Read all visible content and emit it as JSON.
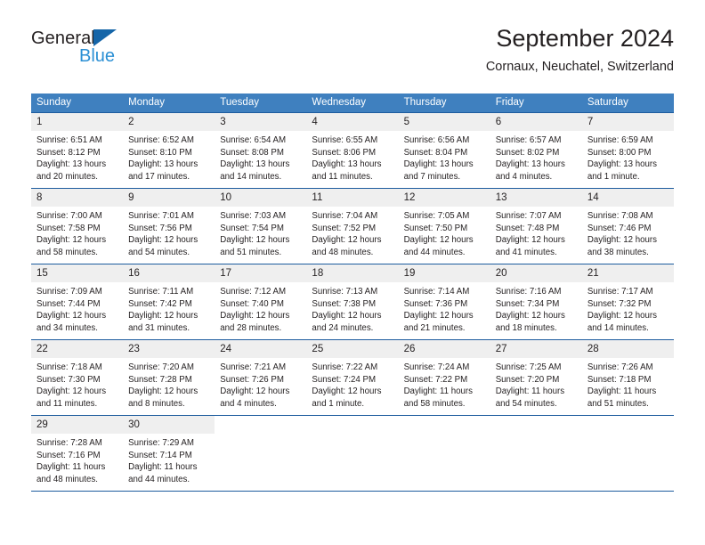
{
  "brand": {
    "name_part1": "General",
    "name_part2": "Blue",
    "logo_icon": "triangle-icon",
    "colors": {
      "dark": "#231f20",
      "blue": "#2a8fd4",
      "triangle": "#1565a8"
    }
  },
  "header": {
    "title": "September 2024",
    "subtitle": "Cornaux, Neuchatel, Switzerland"
  },
  "calendar": {
    "accent_header_bg": "#3f80bf",
    "row_border": "#1d5c9e",
    "daynum_bg": "#efefef",
    "weekdays": [
      "Sunday",
      "Monday",
      "Tuesday",
      "Wednesday",
      "Thursday",
      "Friday",
      "Saturday"
    ],
    "weeks": [
      [
        {
          "day": "1",
          "sunrise": "Sunrise: 6:51 AM",
          "sunset": "Sunset: 8:12 PM",
          "daylight": "Daylight: 13 hours and 20 minutes."
        },
        {
          "day": "2",
          "sunrise": "Sunrise: 6:52 AM",
          "sunset": "Sunset: 8:10 PM",
          "daylight": "Daylight: 13 hours and 17 minutes."
        },
        {
          "day": "3",
          "sunrise": "Sunrise: 6:54 AM",
          "sunset": "Sunset: 8:08 PM",
          "daylight": "Daylight: 13 hours and 14 minutes."
        },
        {
          "day": "4",
          "sunrise": "Sunrise: 6:55 AM",
          "sunset": "Sunset: 8:06 PM",
          "daylight": "Daylight: 13 hours and 11 minutes."
        },
        {
          "day": "5",
          "sunrise": "Sunrise: 6:56 AM",
          "sunset": "Sunset: 8:04 PM",
          "daylight": "Daylight: 13 hours and 7 minutes."
        },
        {
          "day": "6",
          "sunrise": "Sunrise: 6:57 AM",
          "sunset": "Sunset: 8:02 PM",
          "daylight": "Daylight: 13 hours and 4 minutes."
        },
        {
          "day": "7",
          "sunrise": "Sunrise: 6:59 AM",
          "sunset": "Sunset: 8:00 PM",
          "daylight": "Daylight: 13 hours and 1 minute."
        }
      ],
      [
        {
          "day": "8",
          "sunrise": "Sunrise: 7:00 AM",
          "sunset": "Sunset: 7:58 PM",
          "daylight": "Daylight: 12 hours and 58 minutes."
        },
        {
          "day": "9",
          "sunrise": "Sunrise: 7:01 AM",
          "sunset": "Sunset: 7:56 PM",
          "daylight": "Daylight: 12 hours and 54 minutes."
        },
        {
          "day": "10",
          "sunrise": "Sunrise: 7:03 AM",
          "sunset": "Sunset: 7:54 PM",
          "daylight": "Daylight: 12 hours and 51 minutes."
        },
        {
          "day": "11",
          "sunrise": "Sunrise: 7:04 AM",
          "sunset": "Sunset: 7:52 PM",
          "daylight": "Daylight: 12 hours and 48 minutes."
        },
        {
          "day": "12",
          "sunrise": "Sunrise: 7:05 AM",
          "sunset": "Sunset: 7:50 PM",
          "daylight": "Daylight: 12 hours and 44 minutes."
        },
        {
          "day": "13",
          "sunrise": "Sunrise: 7:07 AM",
          "sunset": "Sunset: 7:48 PM",
          "daylight": "Daylight: 12 hours and 41 minutes."
        },
        {
          "day": "14",
          "sunrise": "Sunrise: 7:08 AM",
          "sunset": "Sunset: 7:46 PM",
          "daylight": "Daylight: 12 hours and 38 minutes."
        }
      ],
      [
        {
          "day": "15",
          "sunrise": "Sunrise: 7:09 AM",
          "sunset": "Sunset: 7:44 PM",
          "daylight": "Daylight: 12 hours and 34 minutes."
        },
        {
          "day": "16",
          "sunrise": "Sunrise: 7:11 AM",
          "sunset": "Sunset: 7:42 PM",
          "daylight": "Daylight: 12 hours and 31 minutes."
        },
        {
          "day": "17",
          "sunrise": "Sunrise: 7:12 AM",
          "sunset": "Sunset: 7:40 PM",
          "daylight": "Daylight: 12 hours and 28 minutes."
        },
        {
          "day": "18",
          "sunrise": "Sunrise: 7:13 AM",
          "sunset": "Sunset: 7:38 PM",
          "daylight": "Daylight: 12 hours and 24 minutes."
        },
        {
          "day": "19",
          "sunrise": "Sunrise: 7:14 AM",
          "sunset": "Sunset: 7:36 PM",
          "daylight": "Daylight: 12 hours and 21 minutes."
        },
        {
          "day": "20",
          "sunrise": "Sunrise: 7:16 AM",
          "sunset": "Sunset: 7:34 PM",
          "daylight": "Daylight: 12 hours and 18 minutes."
        },
        {
          "day": "21",
          "sunrise": "Sunrise: 7:17 AM",
          "sunset": "Sunset: 7:32 PM",
          "daylight": "Daylight: 12 hours and 14 minutes."
        }
      ],
      [
        {
          "day": "22",
          "sunrise": "Sunrise: 7:18 AM",
          "sunset": "Sunset: 7:30 PM",
          "daylight": "Daylight: 12 hours and 11 minutes."
        },
        {
          "day": "23",
          "sunrise": "Sunrise: 7:20 AM",
          "sunset": "Sunset: 7:28 PM",
          "daylight": "Daylight: 12 hours and 8 minutes."
        },
        {
          "day": "24",
          "sunrise": "Sunrise: 7:21 AM",
          "sunset": "Sunset: 7:26 PM",
          "daylight": "Daylight: 12 hours and 4 minutes."
        },
        {
          "day": "25",
          "sunrise": "Sunrise: 7:22 AM",
          "sunset": "Sunset: 7:24 PM",
          "daylight": "Daylight: 12 hours and 1 minute."
        },
        {
          "day": "26",
          "sunrise": "Sunrise: 7:24 AM",
          "sunset": "Sunset: 7:22 PM",
          "daylight": "Daylight: 11 hours and 58 minutes."
        },
        {
          "day": "27",
          "sunrise": "Sunrise: 7:25 AM",
          "sunset": "Sunset: 7:20 PM",
          "daylight": "Daylight: 11 hours and 54 minutes."
        },
        {
          "day": "28",
          "sunrise": "Sunrise: 7:26 AM",
          "sunset": "Sunset: 7:18 PM",
          "daylight": "Daylight: 11 hours and 51 minutes."
        }
      ],
      [
        {
          "day": "29",
          "sunrise": "Sunrise: 7:28 AM",
          "sunset": "Sunset: 7:16 PM",
          "daylight": "Daylight: 11 hours and 48 minutes."
        },
        {
          "day": "30",
          "sunrise": "Sunrise: 7:29 AM",
          "sunset": "Sunset: 7:14 PM",
          "daylight": "Daylight: 11 hours and 44 minutes."
        },
        {
          "day": "",
          "sunrise": "",
          "sunset": "",
          "daylight": ""
        },
        {
          "day": "",
          "sunrise": "",
          "sunset": "",
          "daylight": ""
        },
        {
          "day": "",
          "sunrise": "",
          "sunset": "",
          "daylight": ""
        },
        {
          "day": "",
          "sunrise": "",
          "sunset": "",
          "daylight": ""
        },
        {
          "day": "",
          "sunrise": "",
          "sunset": "",
          "daylight": ""
        }
      ]
    ]
  }
}
